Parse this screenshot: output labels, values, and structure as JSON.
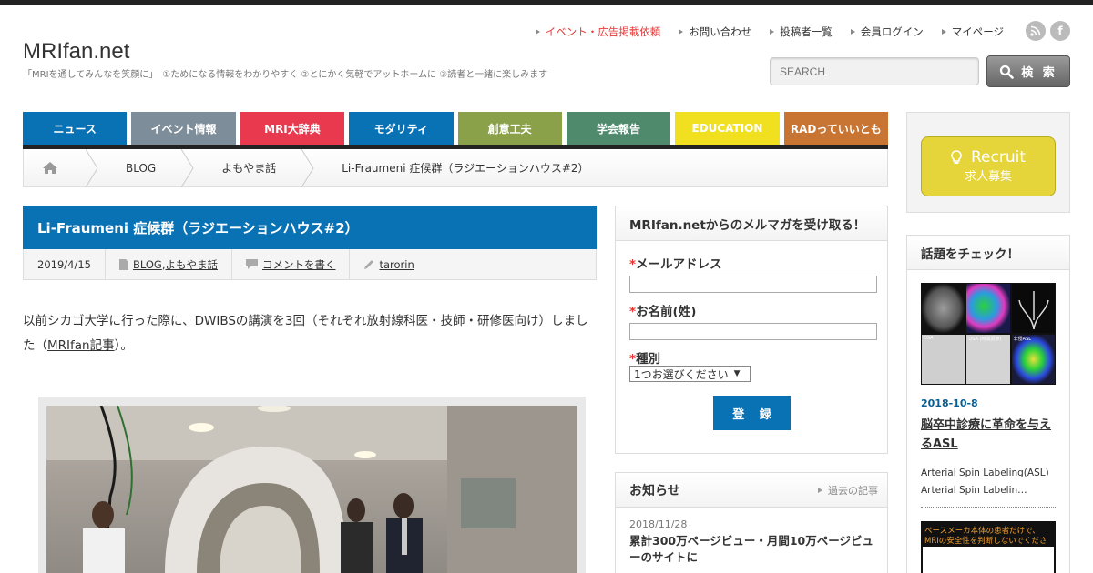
{
  "site": {
    "title": "MRIfan.net",
    "description": "「MRIを通してみんなを笑顔に」　①ためになる情報をわかりやすく ②とにかく気軽でアットホームに ③読者と一緒に楽しみます"
  },
  "topnav": {
    "items": [
      {
        "label": "イベント・広告掲載依頼"
      },
      {
        "label": "お問い合わせ"
      },
      {
        "label": "投稿者一覧"
      },
      {
        "label": "会員ログイン"
      },
      {
        "label": "マイページ"
      }
    ]
  },
  "social": {
    "rss": "rss-icon",
    "facebook": "f"
  },
  "search": {
    "placeholder": "SEARCH",
    "button_label": "検 索"
  },
  "categories": [
    {
      "label": "ニュース",
      "color": "#0972b5"
    },
    {
      "label": "イベント情報",
      "color": "#7d8d99"
    },
    {
      "label": "MRI大辞典",
      "color": "#e8394f"
    },
    {
      "label": "モダリティ",
      "color": "#0972b5"
    },
    {
      "label": "創意工夫",
      "color": "#8aa14a"
    },
    {
      "label": "学会報告",
      "color": "#4f8a6d"
    },
    {
      "label": "EDUCATION",
      "color": "#f1e01f"
    },
    {
      "label": "RADっていいとも",
      "color": "#c87432"
    }
  ],
  "breadcrumb": {
    "items": [
      {
        "label": "BLOG"
      },
      {
        "label": "よもやま話"
      },
      {
        "label": "Li-Fraumeni 症候群（ラジエーションハウス#2）"
      }
    ]
  },
  "post": {
    "title": "Li-Fraumeni 症候群（ラジエーションハウス#2）",
    "date": "2019/4/15",
    "category_1": "BLOG",
    "category_sep": ", ",
    "category_2": "よもやま話",
    "comment_link": "コメントを書く",
    "author": "tarorin",
    "body_text": "以前シカゴ大学に行った際に、DWIBSの講演を3回（それぞれ放射線科医・技師・研修医向け）しました（",
    "body_link": "MRIfan記事",
    "body_end": "）。"
  },
  "mail": {
    "header": "MRIfan.netからのメルマガを受け取る！",
    "required_mark": "*",
    "email_label": "メールアドレス",
    "name_label": "お名前(姓)",
    "type_label": "種別",
    "type_selected": "1つお選びください",
    "submit_label": "登 録"
  },
  "news": {
    "header": "お知らせ",
    "past_link": "過去の記事",
    "date": "2018/11/28",
    "title": "累計300万ページビュー・月間10万ページビューのサイトに"
  },
  "recruit": {
    "title": "Recruit",
    "subtitle": "求人募集",
    "color": "#e5d43a"
  },
  "topics": {
    "header": "話題をチェック！",
    "thumb_labels": [
      "DSA",
      "DSA (時間調節)",
      "非侵ASL"
    ],
    "date": "2018-10-8",
    "title": "脳卒中診療に革命を与えるASL",
    "desc": "Arterial Spin Labeling(ASL) Arterial Spin Labelin…",
    "banner_text_1": "ペースメーカ本体の患者だけで、",
    "banner_text_2": "MRIの安全性を判断しないでください"
  }
}
